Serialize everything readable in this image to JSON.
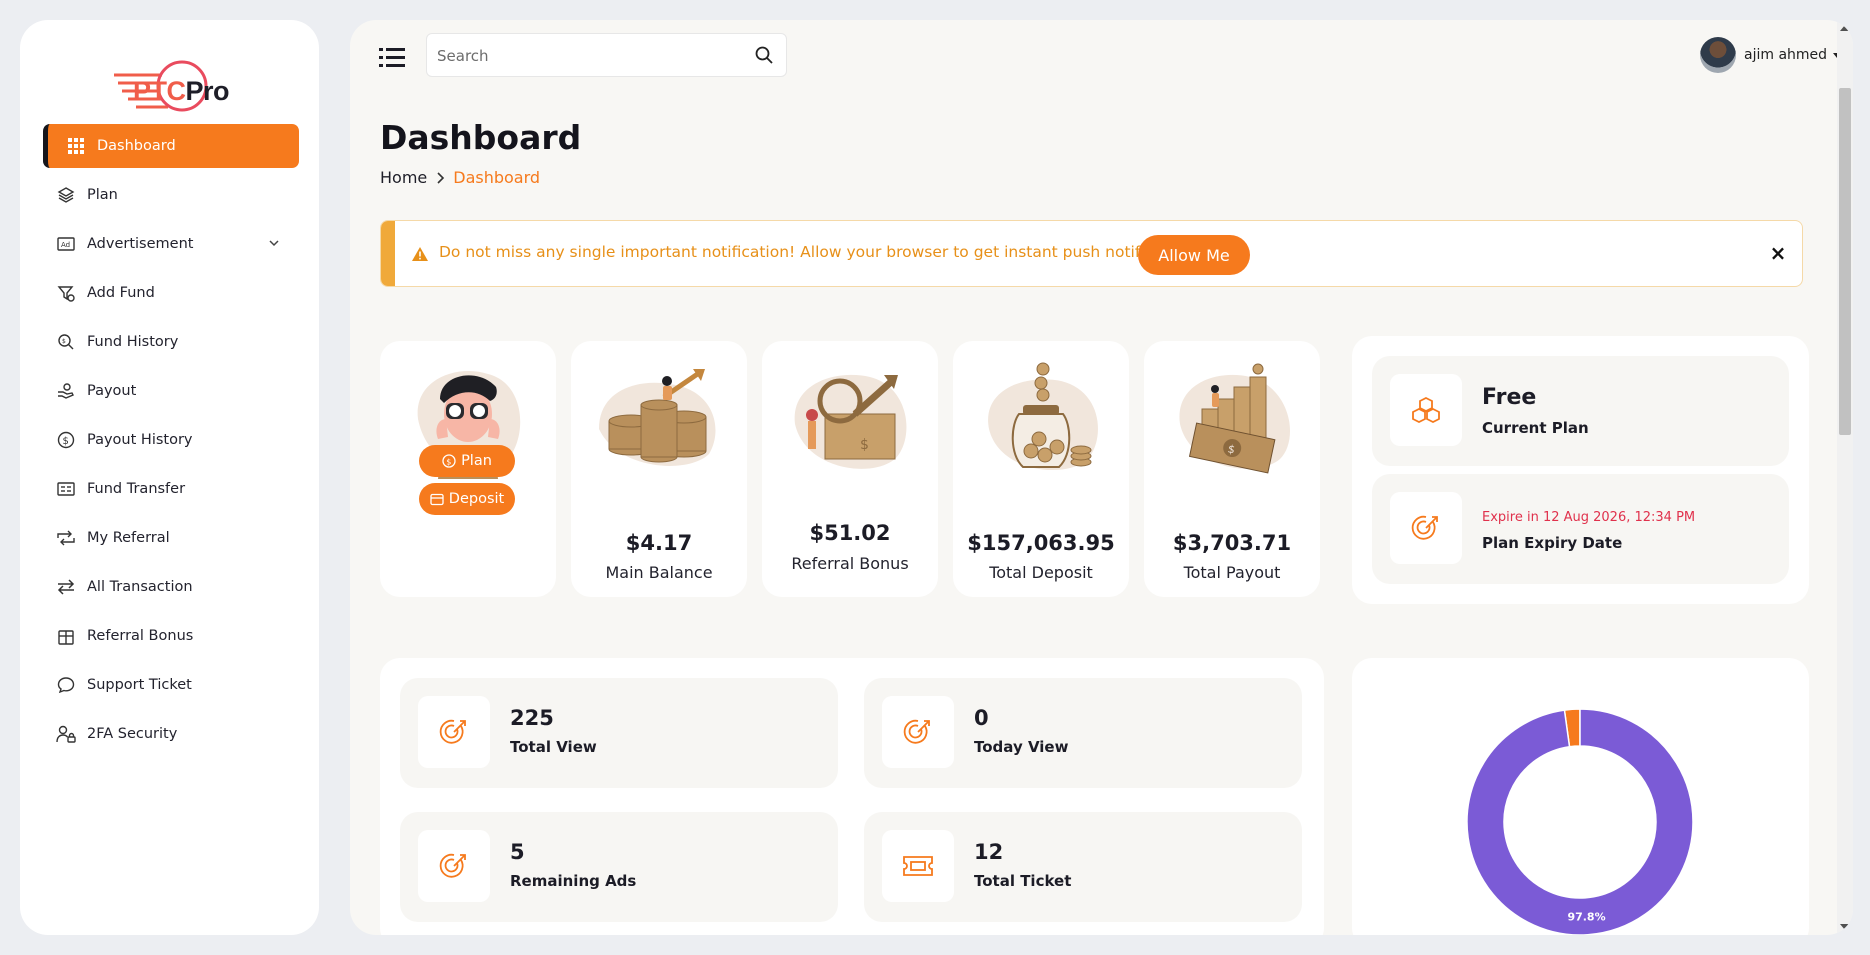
{
  "brand": {
    "logo_part1": "PTC",
    "logo_part2": "Pro"
  },
  "sidebar": {
    "items": [
      {
        "label": "Dashboard",
        "icon": "grid-icon",
        "active": true
      },
      {
        "label": "Plan",
        "icon": "layers-icon"
      },
      {
        "label": "Advertisement",
        "icon": "ad-icon",
        "has_submenu": true
      },
      {
        "label": "Add Fund",
        "icon": "funnel-coin-icon"
      },
      {
        "label": "Fund History",
        "icon": "search-coin-icon"
      },
      {
        "label": "Payout",
        "icon": "hand-coin-icon"
      },
      {
        "label": "Payout History",
        "icon": "dollar-circle-icon"
      },
      {
        "label": "Fund Transfer",
        "icon": "card-icon"
      },
      {
        "label": "My Referral",
        "icon": "repeat-icon"
      },
      {
        "label": "All Transaction",
        "icon": "swap-icon"
      },
      {
        "label": "Referral Bonus",
        "icon": "gift-icon"
      },
      {
        "label": "Support Ticket",
        "icon": "chat-icon"
      },
      {
        "label": "2FA Security",
        "icon": "user-lock-icon"
      }
    ]
  },
  "header": {
    "search_placeholder": "Search",
    "user_name": "ajim ahmed"
  },
  "page": {
    "title": "Dashboard",
    "breadcrumb": {
      "home": "Home",
      "current": "Dashboard"
    }
  },
  "alert": {
    "text": "Do not miss any single important notification! Allow your browser to get instant push notification",
    "button": "Allow Me",
    "close": "×"
  },
  "cards": {
    "actions": {
      "plan_button": "Plan",
      "deposit_button": "Deposit"
    },
    "main_balance": {
      "amount": "$4.17",
      "label": "Main Balance"
    },
    "referral_bonus": {
      "amount": "$51.02",
      "label": "Referral Bonus"
    },
    "total_deposit": {
      "amount": "$157,063.95",
      "label": "Total Deposit"
    },
    "total_payout": {
      "amount": "$3,703.71",
      "label": "Total Payout"
    }
  },
  "plan": {
    "name": "Free",
    "name_label": "Current Plan",
    "expire_text": "Expire in 12 Aug 2026, 12:34 PM",
    "expire_label": "Plan Expiry Date"
  },
  "stats": {
    "total_view": {
      "value": "225",
      "label": "Total View"
    },
    "today_view": {
      "value": "0",
      "label": "Today View"
    },
    "remaining_ads": {
      "value": "5",
      "label": "Remaining Ads"
    },
    "total_ticket": {
      "value": "12",
      "label": "Total Ticket"
    }
  },
  "chart_data": {
    "type": "pie",
    "style": "donut",
    "slices": [
      {
        "value": 97.8,
        "label": "97.8%",
        "color": "#7b5bd6"
      },
      {
        "value": 2.2,
        "label": "",
        "color": "#f67a1d"
      }
    ]
  },
  "colors": {
    "accent": "#f67a1d",
    "purple": "#7b5bd6",
    "danger": "#e0314c",
    "warning": "#e79019"
  }
}
